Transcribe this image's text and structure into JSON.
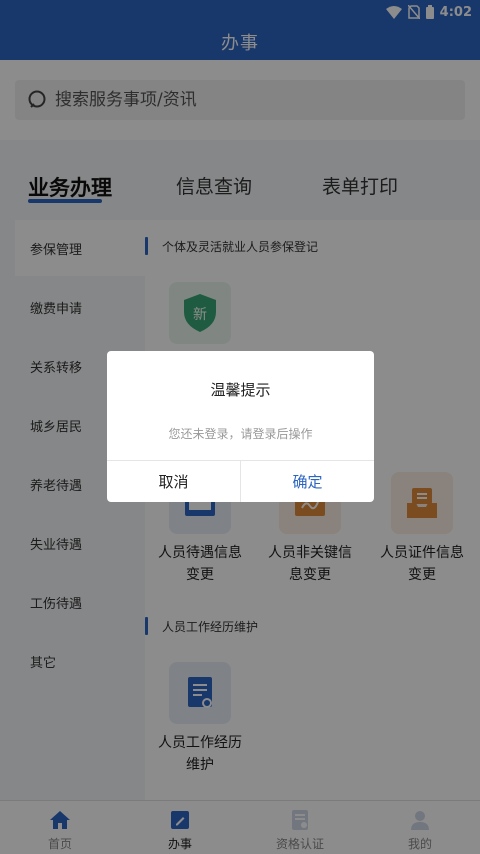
{
  "status_bar": {
    "time": "4:02"
  },
  "header": {
    "title": "办事"
  },
  "search": {
    "placeholder": "搜索服务事项/资讯"
  },
  "tabs": [
    {
      "label": "业务办理",
      "active": true
    },
    {
      "label": "信息查询",
      "active": false
    },
    {
      "label": "表单打印",
      "active": false
    }
  ],
  "sidebar": {
    "items": [
      {
        "label": "参保管理",
        "active": true
      },
      {
        "label": "缴费申请"
      },
      {
        "label": "关系转移"
      },
      {
        "label": "城乡居民"
      },
      {
        "label": "养老待遇"
      },
      {
        "label": "失业待遇"
      },
      {
        "label": "工伤待遇"
      },
      {
        "label": "其它"
      }
    ]
  },
  "content": {
    "sections": [
      {
        "title": "个体及灵活就业人员参保登记",
        "services": [
          {
            "icon_text": "新",
            "icon": "shield-new-icon"
          }
        ]
      },
      {
        "title": "",
        "services": [
          {
            "label_line1": "人员待遇信息",
            "label_line2": "变更",
            "icon": "document-icon"
          },
          {
            "label_line1": "人员非关键信",
            "label_line2": "息变更",
            "icon": "edit-note-icon"
          },
          {
            "label_line1": "人员证件信息",
            "label_line2": "变更",
            "icon": "tray-icon"
          }
        ]
      },
      {
        "title": "人员工作经历维护",
        "services": [
          {
            "label_line1": "人员工作经历",
            "label_line2": "维护",
            "icon": "work-history-icon"
          }
        ]
      }
    ]
  },
  "bottom_nav": [
    {
      "label": "首页",
      "icon": "home-icon"
    },
    {
      "label": "办事",
      "icon": "edit-icon",
      "active": true
    },
    {
      "label": "资格认证",
      "icon": "certificate-icon"
    },
    {
      "label": "我的",
      "icon": "user-icon"
    }
  ],
  "dialog": {
    "title": "温馨提示",
    "message": "您还未登录，请登录后操作",
    "cancel_label": "取消",
    "ok_label": "确定"
  },
  "colors": {
    "primary": "#2c64c2",
    "green_tile": "#3aa776",
    "orange_tile": "#e08b3a"
  }
}
